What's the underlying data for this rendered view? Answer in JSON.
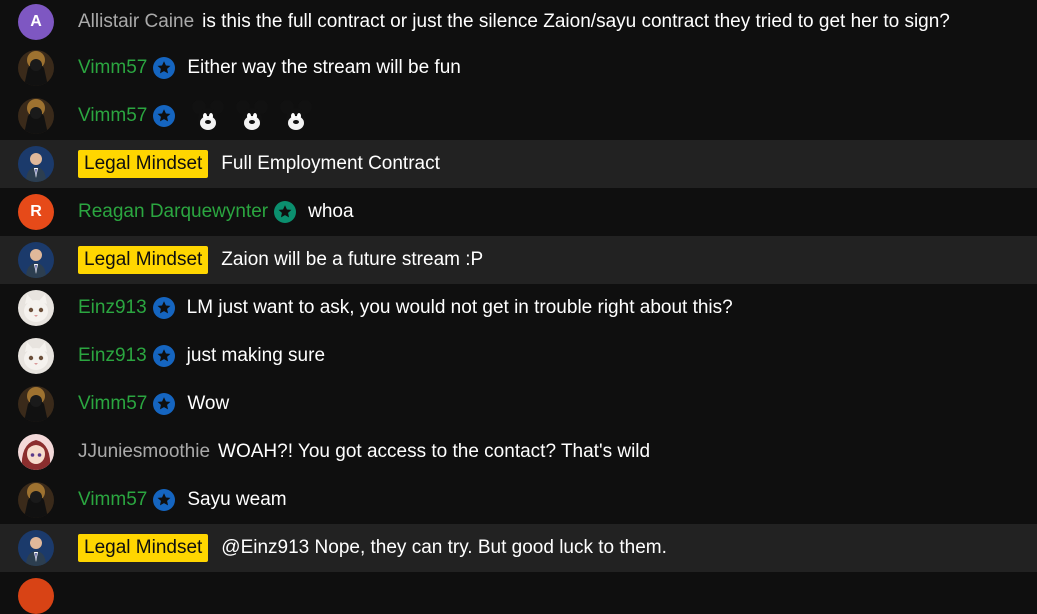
{
  "colors": {
    "background": "#0f0f0f",
    "owner_row": "#222222",
    "owner_badge": "#ffd600",
    "member_name": "#2ba640",
    "regular_name": "#aaaaaa",
    "member_badge_blue": "#1565c0",
    "member_badge_teal": "#0b8f6e"
  },
  "messages": [
    {
      "author": "Allistair Caine",
      "avatar_letter": "A",
      "text": "is this the full contract or just the silence Zaion/sayu contract they tried to get her to sign?"
    },
    {
      "author": "Vimm57",
      "badge": "member-star-icon",
      "text": "Either way the stream will be fun"
    },
    {
      "author": "Vimm57",
      "badge": "member-star-icon",
      "emojis": [
        "mickey-emoji",
        "mickey-emoji",
        "mickey-emoji"
      ]
    },
    {
      "author": "Legal Mindset",
      "owner": true,
      "text": "Full Employment Contract"
    },
    {
      "author": "Reagan Darquewynter",
      "avatar_letter": "R",
      "badge": "member-star-icon",
      "text": "whoa"
    },
    {
      "author": "Legal Mindset",
      "owner": true,
      "text": "Zaion will be a future stream :P"
    },
    {
      "author": "Einz913",
      "badge": "member-star-icon",
      "text": "LM just want to ask, you would not get in trouble right about this?"
    },
    {
      "author": "Einz913",
      "badge": "member-star-icon",
      "text": "just making sure"
    },
    {
      "author": "Vimm57",
      "badge": "member-star-icon",
      "text": "Wow"
    },
    {
      "author": "JJuniesmoothie",
      "text": "WOAH?! You got access to the contact? That's wild"
    },
    {
      "author": "Vimm57",
      "badge": "member-star-icon",
      "text": "Sayu weam"
    },
    {
      "author": "Legal Mindset",
      "owner": true,
      "text": "@Einz913 Nope, they can try. But good luck to them."
    }
  ]
}
